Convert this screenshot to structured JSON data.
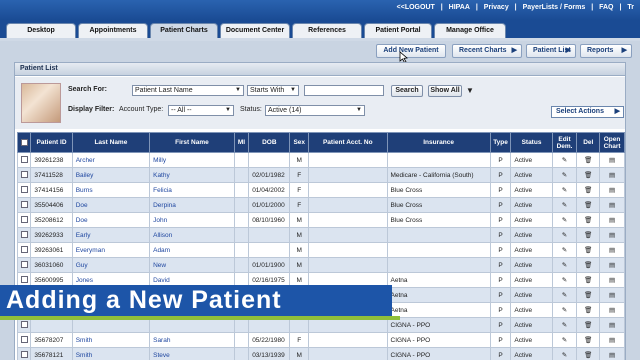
{
  "top_links": [
    "<<LOGOUT",
    "|",
    "HIPAA",
    "|",
    "Privacy",
    "|",
    "PayerLists / Forms",
    "|",
    "FAQ",
    "|",
    "Tr"
  ],
  "tabs": [
    {
      "label": "Desktop"
    },
    {
      "label": "Appointments"
    },
    {
      "label": "Patient Charts"
    },
    {
      "label": "Document Center"
    },
    {
      "label": "References"
    },
    {
      "label": "Patient Portal"
    },
    {
      "label": "Manage Office"
    }
  ],
  "subnav": {
    "add_patient": "Add New Patient",
    "recent_charts": "Recent Charts",
    "patient_list": "Patient List",
    "reports": "Reports"
  },
  "panel_title": "Patient List",
  "filters": {
    "search_for_label": "Search For:",
    "search_field": "Patient Last Name",
    "match_mode": "Starts With",
    "search_value": "",
    "search_button": "Search",
    "show_all_button": "Show All",
    "display_filter_label": "Display Filter:",
    "account_type_label": "Account Type:",
    "account_type_value": "-- All --",
    "status_label": "Status:",
    "status_value": "Active (14)",
    "select_actions": "Select Actions"
  },
  "columns": [
    "Patient ID",
    "Last Name",
    "First Name",
    "MI",
    "DOB",
    "Sex",
    "Patient Acct. No",
    "Insurance",
    "Type",
    "Status",
    "Edit Dem.",
    "Del",
    "Open Chart"
  ],
  "rows": [
    {
      "id": "39261238",
      "last": "Archer",
      "first": "Milly",
      "mi": "",
      "dob": "",
      "sex": "M",
      "acct": "",
      "ins": "",
      "type": "P",
      "status": "Active"
    },
    {
      "id": "37411528",
      "last": "Bailey",
      "first": "Kathy",
      "mi": "",
      "dob": "02/01/1982",
      "sex": "F",
      "acct": "",
      "ins": "Medicare - California (South)",
      "type": "P",
      "status": "Active"
    },
    {
      "id": "37414156",
      "last": "Burns",
      "first": "Felicia",
      "mi": "",
      "dob": "01/04/2002",
      "sex": "F",
      "acct": "",
      "ins": "Blue Cross",
      "type": "P",
      "status": "Active"
    },
    {
      "id": "35504406",
      "last": "Doe",
      "first": "Derpina",
      "mi": "",
      "dob": "01/01/2000",
      "sex": "F",
      "acct": "",
      "ins": "Blue Cross",
      "type": "P",
      "status": "Active"
    },
    {
      "id": "35208612",
      "last": "Doe",
      "first": "John",
      "mi": "",
      "dob": "08/10/1960",
      "sex": "M",
      "acct": "",
      "ins": "Blue Cross",
      "type": "P",
      "status": "Active"
    },
    {
      "id": "39262933",
      "last": "Early",
      "first": "Allison",
      "mi": "",
      "dob": "",
      "sex": "M",
      "acct": "",
      "ins": "",
      "type": "P",
      "status": "Active"
    },
    {
      "id": "39263061",
      "last": "Everyman",
      "first": "Adam",
      "mi": "",
      "dob": "",
      "sex": "M",
      "acct": "",
      "ins": "",
      "type": "P",
      "status": "Active"
    },
    {
      "id": "36031060",
      "last": "Guy",
      "first": "New",
      "mi": "",
      "dob": "01/01/1900",
      "sex": "M",
      "acct": "",
      "ins": "",
      "type": "P",
      "status": "Active"
    },
    {
      "id": "35600995",
      "last": "Jones",
      "first": "David",
      "mi": "",
      "dob": "02/16/1975",
      "sex": "M",
      "acct": "",
      "ins": "Aetna",
      "type": "P",
      "status": "Active"
    },
    {
      "id": "",
      "last": "",
      "first": "",
      "mi": "",
      "dob": "",
      "sex": "",
      "acct": "",
      "ins": "Aetna",
      "type": "P",
      "status": "Active"
    },
    {
      "id": "",
      "last": "",
      "first": "",
      "mi": "",
      "dob": "",
      "sex": "",
      "acct": "",
      "ins": "Aetna",
      "type": "P",
      "status": "Active"
    },
    {
      "id": "",
      "last": "",
      "first": "",
      "mi": "",
      "dob": "",
      "sex": "",
      "acct": "",
      "ins": "CIGNA - PPO",
      "type": "P",
      "status": "Active"
    },
    {
      "id": "35678207",
      "last": "Smith",
      "first": "Sarah",
      "mi": "",
      "dob": "05/22/1980",
      "sex": "F",
      "acct": "",
      "ins": "CIGNA - PPO",
      "type": "P",
      "status": "Active"
    },
    {
      "id": "35678121",
      "last": "Smith",
      "first": "Steve",
      "mi": "",
      "dob": "03/13/1939",
      "sex": "M",
      "acct": "",
      "ins": "CIGNA - PPO",
      "type": "P",
      "status": "Active"
    }
  ],
  "banner_text": "Adding a New Patient"
}
